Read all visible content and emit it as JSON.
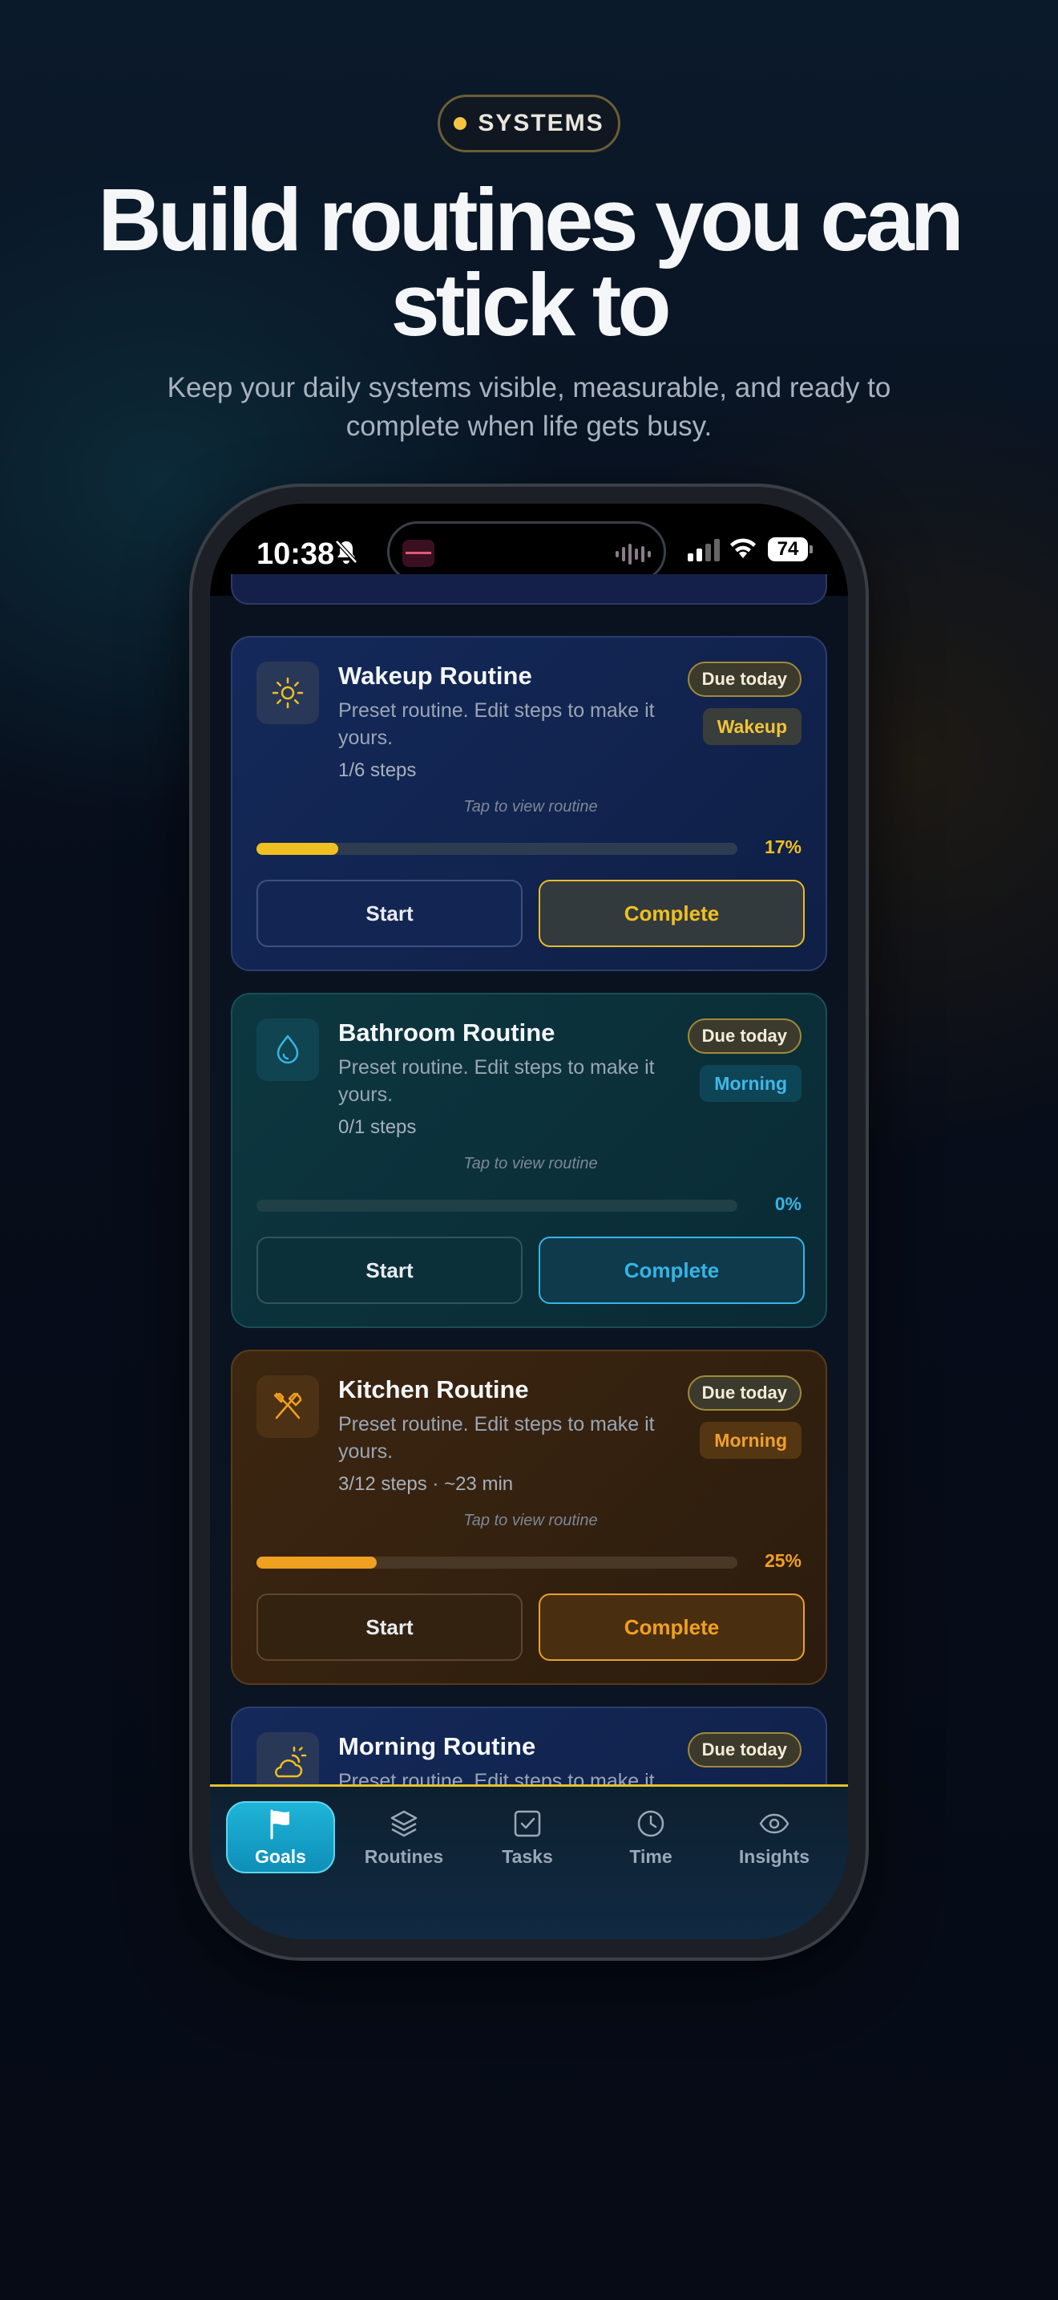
{
  "hero": {
    "eyebrow": "SYSTEMS",
    "headline": "Build routines you can stick to",
    "subline": "Keep your daily systems visible, measurable, and ready to complete when life gets busy."
  },
  "status_bar": {
    "time": "10:38",
    "battery": "74"
  },
  "cards": [
    {
      "title": "Wakeup Routine",
      "description": "Preset routine. Edit steps to make it yours.",
      "steps": "1/6 steps",
      "tap_hint": "Tap to view routine",
      "due": "Due today",
      "category": "Wakeup",
      "progress_percent": 17,
      "progress_label": "17%",
      "start_label": "Start",
      "complete_label": "Complete",
      "icon": "sun-icon",
      "accent": "#f0c020"
    },
    {
      "title": "Bathroom Routine",
      "description": "Preset routine. Edit steps to make it yours.",
      "steps": "0/1 steps",
      "tap_hint": "Tap to view routine",
      "due": "Due today",
      "category": "Morning",
      "progress_percent": 0,
      "progress_label": "0%",
      "start_label": "Start",
      "complete_label": "Complete",
      "icon": "water-drop-icon",
      "accent": "#36b4e4"
    },
    {
      "title": "Kitchen Routine",
      "description": "Preset routine. Edit steps to make it yours.",
      "steps": "3/12 steps · ~23 min",
      "tap_hint": "Tap to view routine",
      "due": "Due today",
      "category": "Morning",
      "progress_percent": 25,
      "progress_label": "25%",
      "start_label": "Start",
      "complete_label": "Complete",
      "icon": "utensils-icon",
      "accent": "#f0a020"
    },
    {
      "title": "Morning Routine",
      "description": "Preset routine. Edit steps to make it",
      "due": "Due today",
      "icon": "sun-cloud-icon"
    }
  ],
  "tabs": [
    {
      "label": "Goals",
      "icon": "flag-icon",
      "active": true
    },
    {
      "label": "Routines",
      "icon": "layers-icon",
      "active": false
    },
    {
      "label": "Tasks",
      "icon": "checkbox-icon",
      "active": false
    },
    {
      "label": "Time",
      "icon": "clock-icon",
      "active": false
    },
    {
      "label": "Insights",
      "icon": "eye-icon",
      "active": false
    }
  ]
}
